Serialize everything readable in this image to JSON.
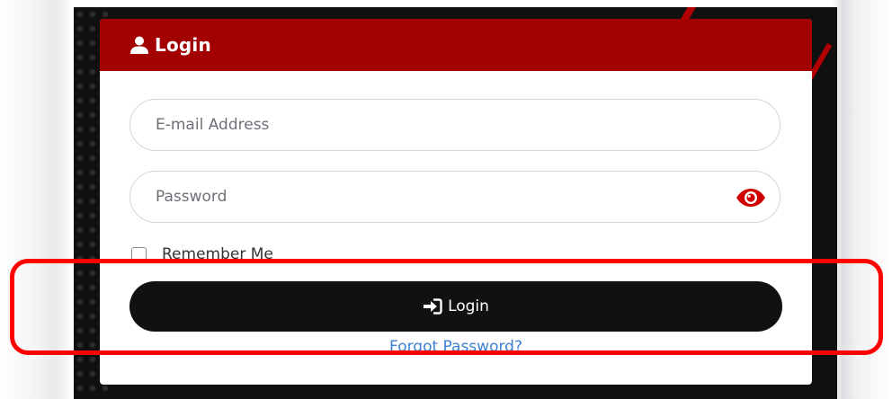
{
  "header": {
    "title": "Login",
    "icon": "user-icon"
  },
  "form": {
    "email_placeholder": "E-mail Address",
    "email_value": "",
    "password_placeholder": "Password",
    "password_value": "",
    "password_toggle_icon": "eye-icon",
    "remember_label": "Remember Me",
    "remember_checked": false,
    "login_button_label": "Login",
    "login_button_icon": "sign-in-icon",
    "forgot_label": "Forgot Password?"
  },
  "colors": {
    "header_bg": "#a30000",
    "button_bg": "#111111",
    "link": "#3b7fd6",
    "eye_icon": "#d10000",
    "highlight": "#ff0000"
  }
}
